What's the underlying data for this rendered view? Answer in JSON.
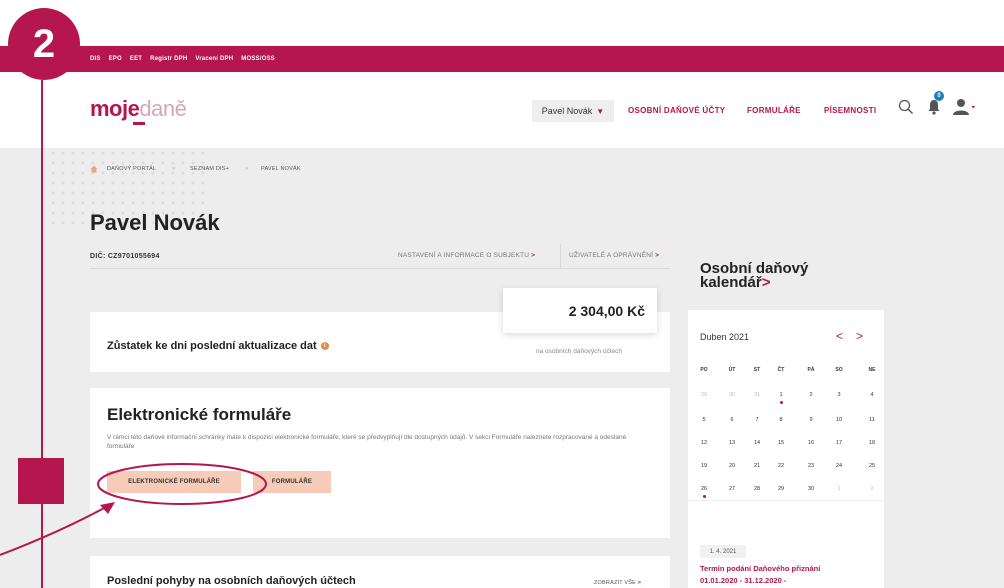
{
  "step": {
    "number": "2"
  },
  "topnav": {
    "items": [
      "DIS",
      "EPO",
      "EET",
      "Registr DPH",
      "Vracení DPH",
      "MOSS/OSS"
    ]
  },
  "header": {
    "logo": {
      "part1": "moje",
      "part2": "daně"
    },
    "user": {
      "name": "Pavel Novák"
    },
    "nav": [
      "OSOBNÍ DAŇOVÉ ÚČTY",
      "FORMULÁŘE",
      "PÍSEMNOSTI"
    ],
    "notification_count": "0"
  },
  "breadcrumb": [
    "DAŇOVÝ PORTÁL",
    "SEZNAM DIS+",
    "PAVEL NOVÁK"
  ],
  "breadcrumb_sep": ">",
  "page": {
    "title": "Pavel Novák",
    "dic": "DIČ: CZ9701055694",
    "subject_link": "NASTAVENÍ A INFORMACE O SUBJEKTU",
    "users_link": "UŽIVATELÉ A OPRÁVNĚNÍ",
    "link_arrow": ">"
  },
  "balance": {
    "amount": "2 304,00 Kč",
    "label": "Zůstatek ke dni poslední aktualizace dat",
    "info": "i",
    "note": "na osobních daňových účtech"
  },
  "forms": {
    "title": "Elektronické formuláře",
    "description": "V rámci této daňové informační schránky máte k dispozici elektronické formuláře, které se předvyplňují dle dostupných údajů. V sekci Formuláře naleznete rozpracované a odeslané formuláře",
    "btn_electronic": "ELEKTRONICKÉ FORMULÁŘE",
    "btn_forms": "FORMULÁŘE"
  },
  "movements": {
    "title": "Poslední pohyby na osobních daňových účtech",
    "show_all": "ZOBRAZIT VŠE",
    "arrow": ">"
  },
  "calendar": {
    "title_line1": "Osobní daňový",
    "title_line2": "kalendář",
    "chev": ">",
    "month": "Duben 2021",
    "prev": "<",
    "next": ">",
    "dow": [
      "PO",
      "ÚT",
      "ST",
      "ČT",
      "PÁ",
      "SO",
      "NE"
    ],
    "weeks": [
      [
        "29",
        "30",
        "31",
        "1",
        "2",
        "3",
        "4"
      ],
      [
        "5",
        "6",
        "7",
        "8",
        "9",
        "10",
        "11"
      ],
      [
        "12",
        "13",
        "14",
        "15",
        "16",
        "17",
        "18"
      ],
      [
        "19",
        "20",
        "21",
        "22",
        "23",
        "24",
        "25"
      ],
      [
        "26",
        "27",
        "28",
        "29",
        "30",
        "1",
        "2"
      ]
    ],
    "event": {
      "date": "1. 4. 2021",
      "line1": "Termín podání Daňového přiznání",
      "line2": "01.01.2020 - 31.12.2020 -"
    }
  },
  "colors": {
    "accent": "#b5164d",
    "peach": "#f6cbb7",
    "badge_blue": "#1a80b4"
  }
}
